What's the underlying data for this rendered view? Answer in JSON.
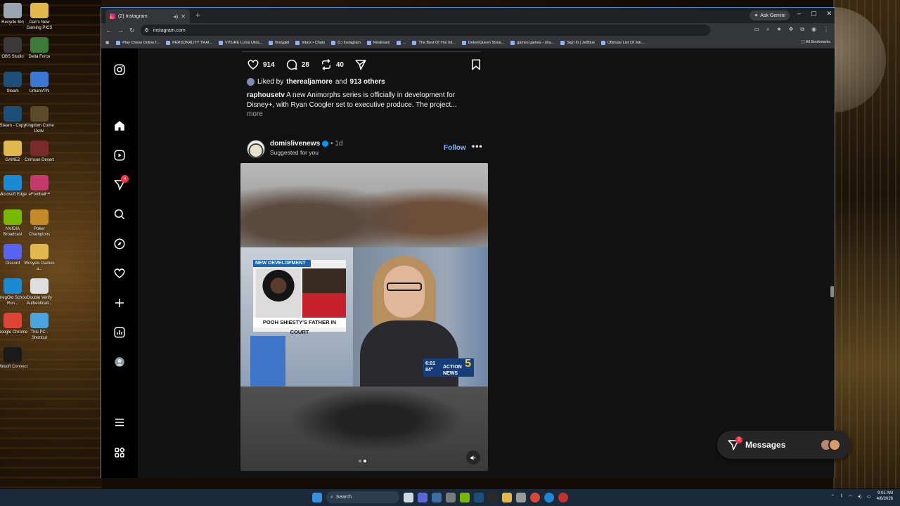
{
  "desktop": {
    "icons": [
      {
        "label": "Recycle Bin",
        "color": "#9aa5b1"
      },
      {
        "label": "Dan's New Gaming PICS",
        "color": "#e0b84c"
      },
      {
        "label": "OBS Studio",
        "color": "#3a3a3a"
      },
      {
        "label": "Delta Force",
        "color": "#3e7a3a"
      },
      {
        "label": "Steam",
        "color": "#1b4f7a"
      },
      {
        "label": "UrbanVPN",
        "color": "#3a78d4"
      },
      {
        "label": "Steam - Copy",
        "color": "#1b4f7a"
      },
      {
        "label": "Kingdom Come Deliv.",
        "color": "#5a4a2a"
      },
      {
        "label": "GAMEZ",
        "color": "#e0b84c"
      },
      {
        "label": "Crimson Desert",
        "color": "#7a2a2a"
      },
      {
        "label": "Microsoft Edge",
        "color": "#1b8ad4"
      },
      {
        "label": "eFootball™",
        "color": "#c43a6a"
      },
      {
        "label": "NVIDIA Broadcast",
        "color": "#76b900"
      },
      {
        "label": "Poker Champions",
        "color": "#c48a2a"
      },
      {
        "label": "Discord",
        "color": "#5865f2"
      },
      {
        "label": "Wcsyels Games a...",
        "color": "#e0b84c"
      },
      {
        "label": "GregOld School Run...",
        "color": "#1b8ad4"
      },
      {
        "label": "Double Verify Authenticati...",
        "color": "#dedede"
      },
      {
        "label": "Google Chrome",
        "color": "#db4437"
      },
      {
        "label": "This PC - Shortcut",
        "color": "#4aa3df"
      },
      {
        "label": "Ubisoft Connect",
        "color": "#1a1a1a"
      }
    ]
  },
  "browser": {
    "tab_title": "(2) Instagram",
    "ask_gemini": "Ask Gemini",
    "url": "instagram.com",
    "bookmarks": [
      "Play Chess Online f...",
      "PERSONALITY TRAI...",
      "VITURE Luma Ultra...",
      "firstygidl",
      "Inbox • Chats",
      "(1) Instagram",
      "Restream",
      "...",
      "The Best Of The Int...",
      "DeleniQueen Strea...",
      "games games - sha...",
      "Sign In | JetBlue",
      "Ultimate List Of Jok..."
    ],
    "all_bookmarks": "All Bookmarks"
  },
  "instagram": {
    "nav": {
      "notifications_count": "4"
    },
    "prev_post": {
      "likes": "914",
      "comments": "28",
      "reposts": "40",
      "liked_by_prefix": "Liked by",
      "liked_by_user": "therealjamore",
      "liked_by_and": "and",
      "liked_by_others": "913 others",
      "caption_user": "raphousetv",
      "caption_text": "A new Animorphs series is officially in development for Disney+, with Ryan Coogler set to executive produce. The project...",
      "more": "more"
    },
    "post": {
      "username": "domislivenews",
      "time": "• 1d",
      "subtitle": "Suggested for you",
      "follow": "Follow",
      "video": {
        "tag": "NEW DEVELOPMENT",
        "headline": "POOH SHIESTY'S FATHER IN COURT",
        "logo_time": "6:01",
        "logo_temp": "84°",
        "logo_text": "ACTION NEWS",
        "logo_num": "5"
      }
    },
    "messages": {
      "label": "Messages",
      "badge": "2"
    }
  },
  "taskbar": {
    "search_placeholder": "Search",
    "time": "9:01 AM",
    "date": "4/6/2026"
  }
}
